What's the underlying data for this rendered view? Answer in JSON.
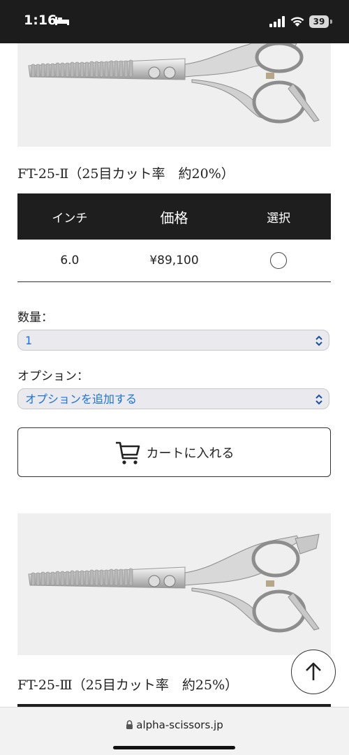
{
  "status_bar": {
    "time": "1:16",
    "battery": "39"
  },
  "product1": {
    "title": "FT-25-Ⅱ（25目カット率　約20%）",
    "table": {
      "headers": [
        "インチ",
        "価格",
        "選択"
      ],
      "rows": [
        {
          "inch": "6.0",
          "price": "¥89,100",
          "selected": false
        }
      ]
    },
    "quantity_label": "数量：",
    "quantity_value": "1",
    "option_label": "オプション：",
    "option_value": "オプションを追加する",
    "cart_button": "カートに入れる"
  },
  "product2": {
    "title": "FT-25-Ⅲ（25目カット率　約25%）"
  },
  "browser": {
    "url": "alpha-scissors.jp"
  },
  "colors": {
    "header_bg": "#1e1e1e",
    "select_text": "#1a73d9",
    "image_bg": "#efefef"
  }
}
